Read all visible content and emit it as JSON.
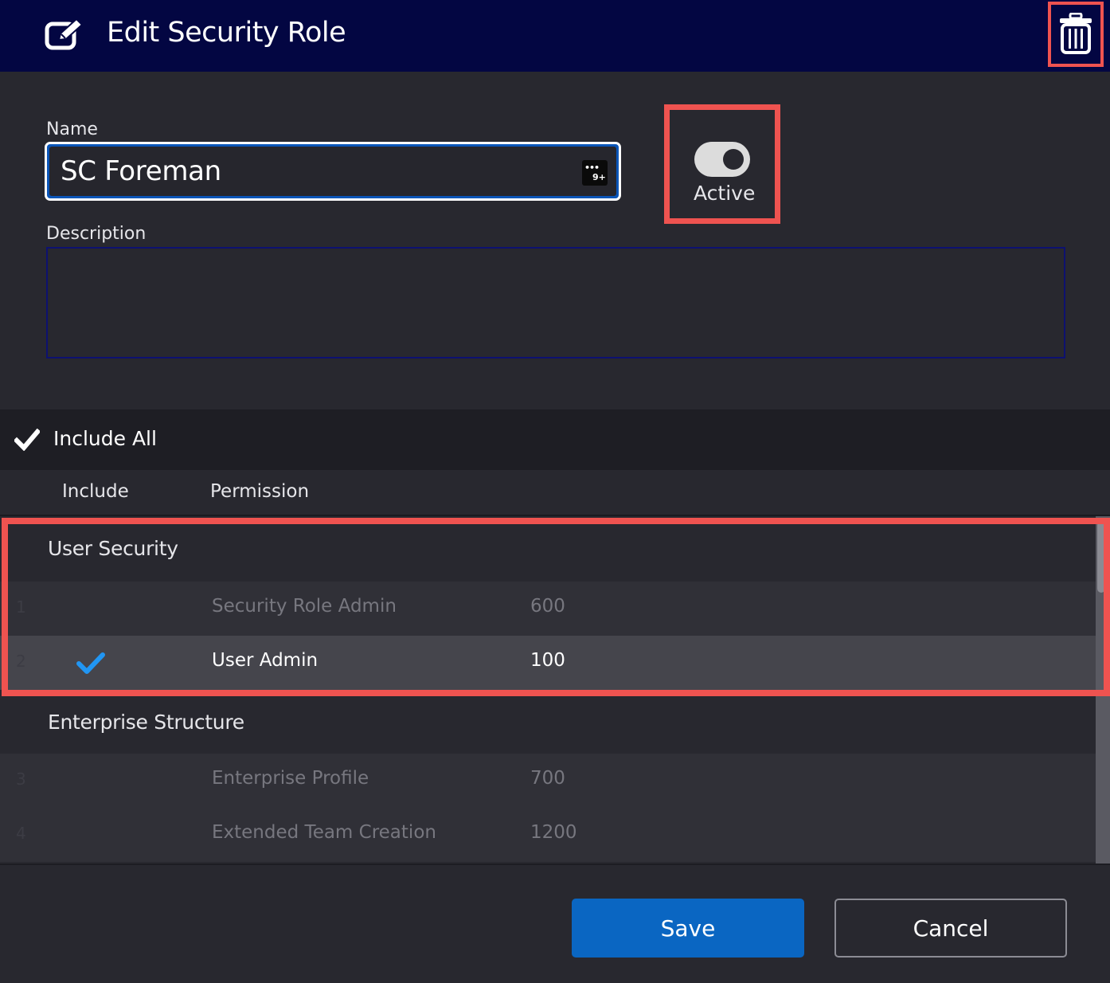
{
  "header": {
    "title": "Edit Security Role",
    "edit_icon": "edit-icon",
    "delete_icon": "trash-icon",
    "background": "#030642"
  },
  "form": {
    "name_label": "Name",
    "name_value": "SC Foreman",
    "name_badge_dots": "•••",
    "name_badge_count": "9+",
    "active_label": "Active",
    "active_on": true,
    "description_label": "Description",
    "description_value": ""
  },
  "permissions": {
    "include_all_label": "Include All",
    "columns": {
      "include": "Include",
      "permission": "Permission"
    },
    "groups": [
      {
        "name": "User Security",
        "rows": [
          {
            "num": "1",
            "permission": "Security Role Admin",
            "value": "600",
            "included": false
          },
          {
            "num": "2",
            "permission": "User Admin",
            "value": "100",
            "included": true
          }
        ]
      },
      {
        "name": "Enterprise Structure",
        "rows": [
          {
            "num": "3",
            "permission": "Enterprise Profile",
            "value": "700",
            "included": false
          },
          {
            "num": "4",
            "permission": "Extended Team Creation",
            "value": "1200",
            "included": false
          }
        ]
      }
    ]
  },
  "footer": {
    "save_label": "Save",
    "cancel_label": "Cancel"
  },
  "colors": {
    "accent": "#0a66c2",
    "check_blue": "#2196f3",
    "highlight": "#ef5350"
  }
}
